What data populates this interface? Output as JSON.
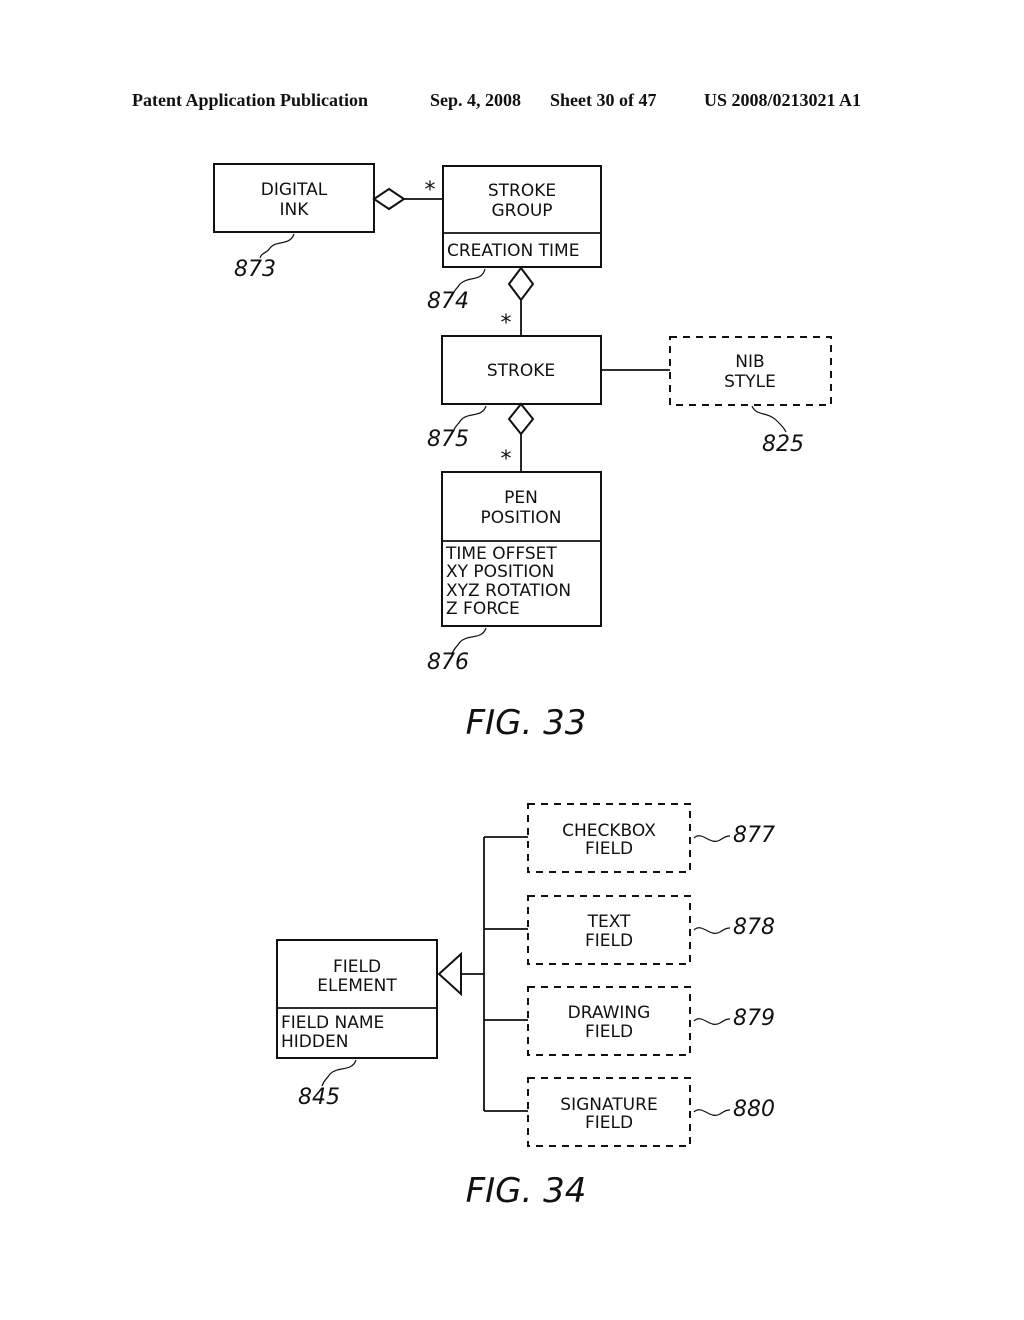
{
  "header": {
    "publication": "Patent Application Publication",
    "date": "Sep. 4, 2008",
    "sheet": "Sheet 30 of 47",
    "number": "US 2008/0213021 A1"
  },
  "fig33": {
    "caption": "FIG. 33",
    "multiplicity": "*",
    "digital_ink": {
      "lines": [
        "DIGITAL",
        "INK"
      ],
      "ref": "873"
    },
    "stroke_group": {
      "lines": [
        "STROKE",
        "GROUP"
      ],
      "attributes": [
        "CREATION TIME"
      ],
      "ref": "874"
    },
    "stroke": {
      "lines": [
        "STROKE"
      ],
      "ref": "875"
    },
    "nib_style": {
      "lines": [
        "NIB",
        "STYLE"
      ],
      "ref": "825"
    },
    "pen_position": {
      "lines": [
        "PEN",
        "POSITION"
      ],
      "attributes": [
        "TIME OFFSET",
        "XY POSITION",
        "XYZ ROTATION",
        "Z FORCE"
      ],
      "ref": "876"
    }
  },
  "fig34": {
    "caption": "FIG. 34",
    "field_element": {
      "lines": [
        "FIELD",
        "ELEMENT"
      ],
      "attributes": [
        "FIELD NAME",
        "HIDDEN"
      ],
      "ref": "845"
    },
    "subclasses": [
      {
        "lines": [
          "CHECKBOX",
          "FIELD"
        ],
        "ref": "877"
      },
      {
        "lines": [
          "TEXT",
          "FIELD"
        ],
        "ref": "878"
      },
      {
        "lines": [
          "DRAWING",
          "FIELD"
        ],
        "ref": "879"
      },
      {
        "lines": [
          "SIGNATURE",
          "FIELD"
        ],
        "ref": "880"
      }
    ]
  }
}
